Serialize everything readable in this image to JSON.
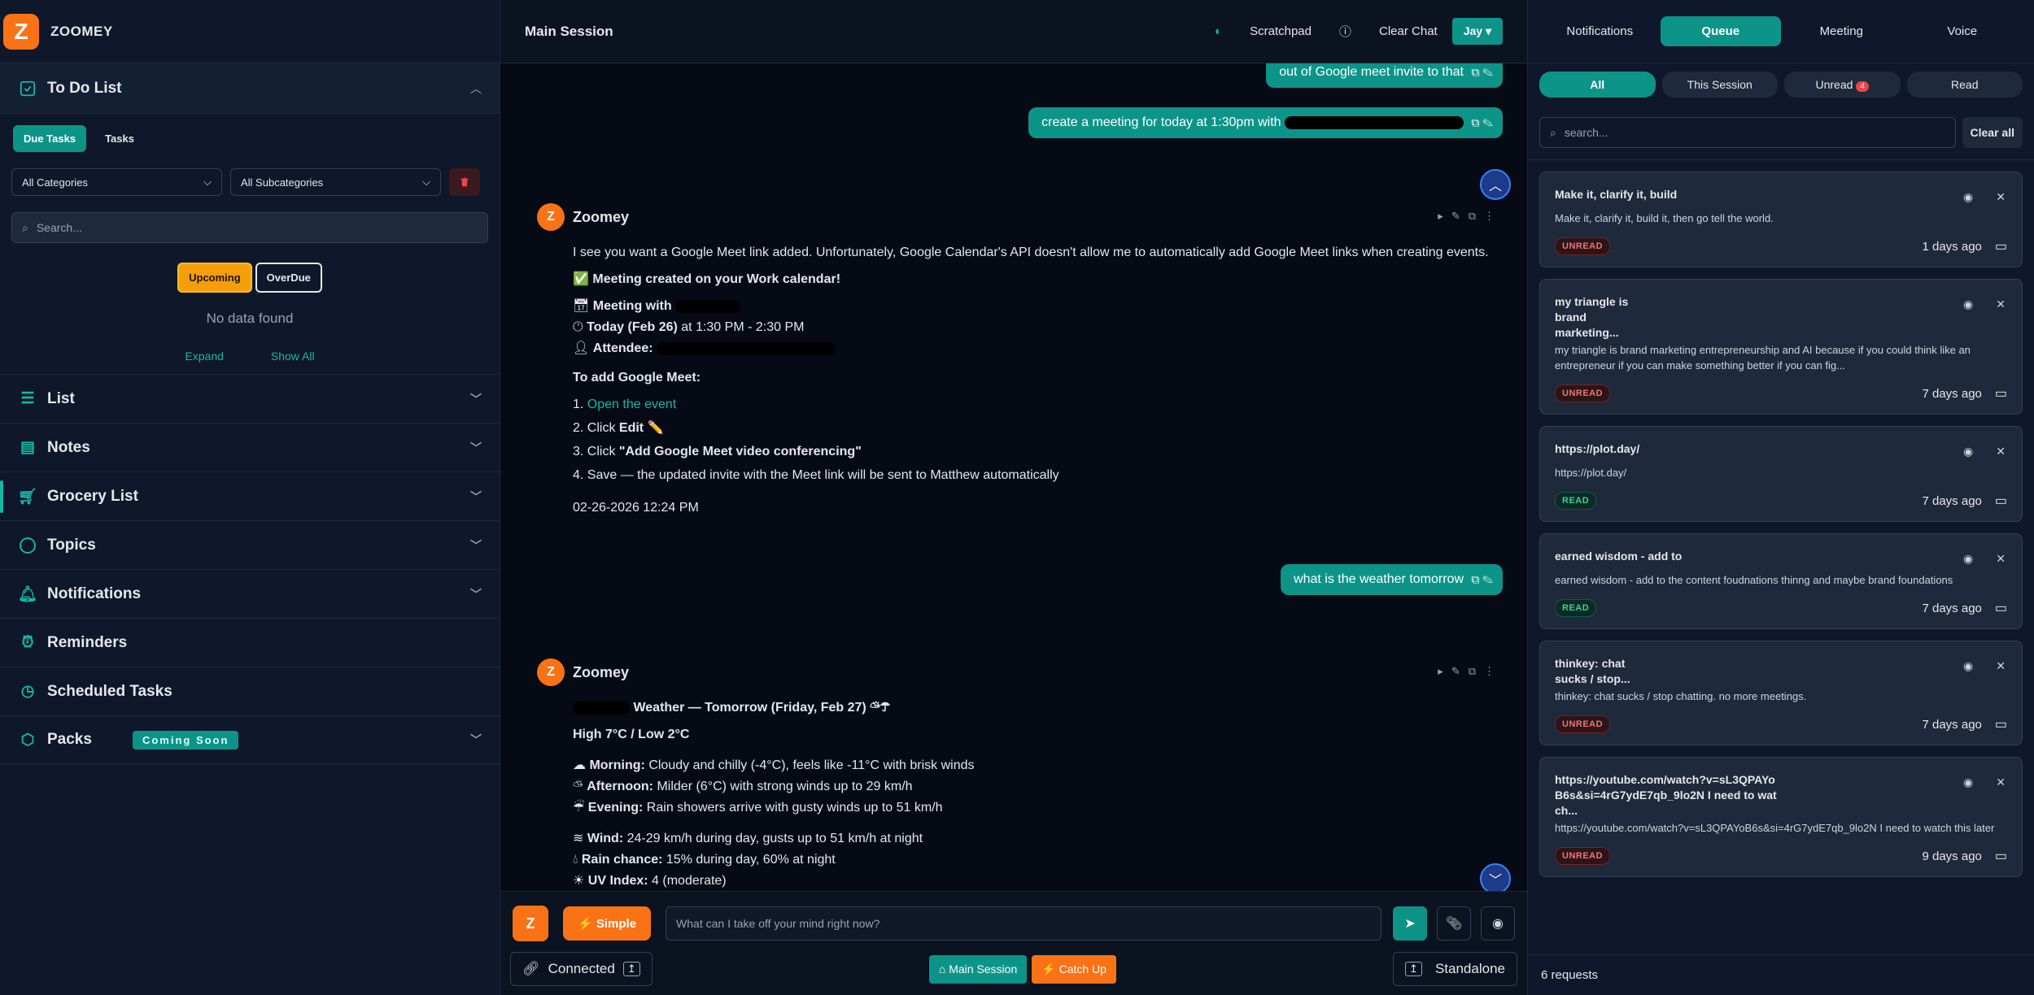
{
  "app": {
    "name": "ZOOMEY",
    "logo_letter": "Z"
  },
  "todo": {
    "title": "To Do List",
    "tabs": [
      "Due Tasks",
      "Tasks"
    ],
    "category": "All Categories",
    "subcategory": "All Subcategories",
    "search_placeholder": "Search...",
    "segments": [
      "Upcoming",
      "OverDue"
    ],
    "empty": "No data found",
    "expand": "Expand",
    "show_all": "Show All"
  },
  "sections": [
    {
      "label": "List",
      "icon": "list-icon"
    },
    {
      "label": "Notes",
      "icon": "notes-icon"
    },
    {
      "label": "Grocery List",
      "icon": "cart-icon"
    },
    {
      "label": "Topics",
      "icon": "chat-bubble-icon"
    },
    {
      "label": "Notifications",
      "icon": "bell-icon"
    },
    {
      "label": "Reminders",
      "icon": "alarm-icon"
    },
    {
      "label": "Scheduled Tasks",
      "icon": "clock-icon"
    },
    {
      "label": "Packs",
      "icon": "box-icon",
      "badge": "Coming Soon"
    }
  ],
  "header": {
    "title": "Main Session",
    "scratchpad": "Scratchpad",
    "clear_chat": "Clear Chat",
    "user": "Jay"
  },
  "chat": {
    "user_msgs": [
      "out of Google meet invite to that",
      "create a meeting for today at 1:30pm with",
      "what is the weather tomorrow"
    ],
    "bot_name": "Zoomey",
    "m1": {
      "p1": "I see you want a Google Meet link added. Unfortunately, Google Calendar's API doesn't allow me to automatically add Google Meet links when creating events.",
      "p2": "✅ Meeting created on your Work calendar!",
      "p3": "Meeting with",
      "p4a": "Today (Feb 26)",
      "p4b": " at 1:30 PM - 2:30 PM",
      "p5": "Attendee:",
      "p6": "To add Google Meet:",
      "s1a": "1. ",
      "s1b": "Open the event",
      "s2a": "2. Click ",
      "s2b": "Edit",
      "s3a": "3. Click ",
      "s3b": "\"Add Google Meet video conferencing\"",
      "s4": "4. Save — the updated invite with the Meet link will be sent to Matthew automatically",
      "time": "02-26-2026 12:24 PM"
    },
    "m2": {
      "title": "Weather — Tomorrow (Friday, Feb 27)",
      "hilo": "High 7°C / Low 2°C",
      "morning_l": "Morning:",
      "morning": " Cloudy and chilly (-4°C), feels like -11°C with brisk winds",
      "afternoon_l": "Afternoon:",
      "afternoon": " Milder (6°C) with strong winds up to 29 km/h",
      "evening_l": "Evening:",
      "evening": " Rain showers arrive with gusty winds up to 51 km/h",
      "wind_l": "Wind:",
      "wind": " 24-29 km/h during day, gusts up to 51 km/h at night",
      "rain_l": "Rain chance:",
      "rain": " 15% during day, 60% at night",
      "uv_l": "UV Index:",
      "uv": " 4 (moderate)"
    }
  },
  "composer": {
    "z": "Z",
    "simple": "Simple",
    "placeholder": "What can I take off your mind right now?",
    "connected": "Connected",
    "main_session": "Main Session",
    "catch_up": "Catch Up",
    "standalone": "Standalone"
  },
  "right": {
    "tabs": [
      "Notifications",
      "Queue",
      "Meeting",
      "Voice"
    ],
    "filters": [
      "All",
      "This Session",
      "Unread",
      "Read"
    ],
    "unread_count": "4",
    "search_placeholder": "search...",
    "clear_all": "Clear all",
    "cards": [
      {
        "title": "Make it, clarify it, build",
        "body": "Make it, clarify it, build it, then go tell the world.",
        "status": "UNREAD",
        "ago": "1 days ago"
      },
      {
        "title": "my triangle is brand marketing...",
        "body": "my triangle is brand marketing entrepreneurship and AI because if you could think like an entrepreneur if you can make something better if you can fig...",
        "status": "UNREAD",
        "ago": "7 days ago"
      },
      {
        "title": "https://plot.day/",
        "body": "https://plot.day/",
        "status": "READ",
        "ago": "7 days ago"
      },
      {
        "title": "earned wisdom - add to",
        "body": "earned wisdom - add to the content foudnations thinng and maybe brand foundations",
        "status": "READ",
        "ago": "7 days ago"
      },
      {
        "title": "thinkey: chat sucks / stop...",
        "body": "thinkey: chat sucks / stop chatting. no more meetings.",
        "status": "UNREAD",
        "ago": "7 days ago"
      },
      {
        "title": "https://youtube.com/watch?v=sL3QPAYoB6s&si=4rG7ydE7qb_9lo2N I need to watch...",
        "body": "https://youtube.com/watch?v=sL3QPAYoB6s&si=4rG7ydE7qb_9lo2N I need to watch this later",
        "status": "UNREAD",
        "ago": "9 days ago"
      }
    ],
    "footer": "6 requests"
  }
}
